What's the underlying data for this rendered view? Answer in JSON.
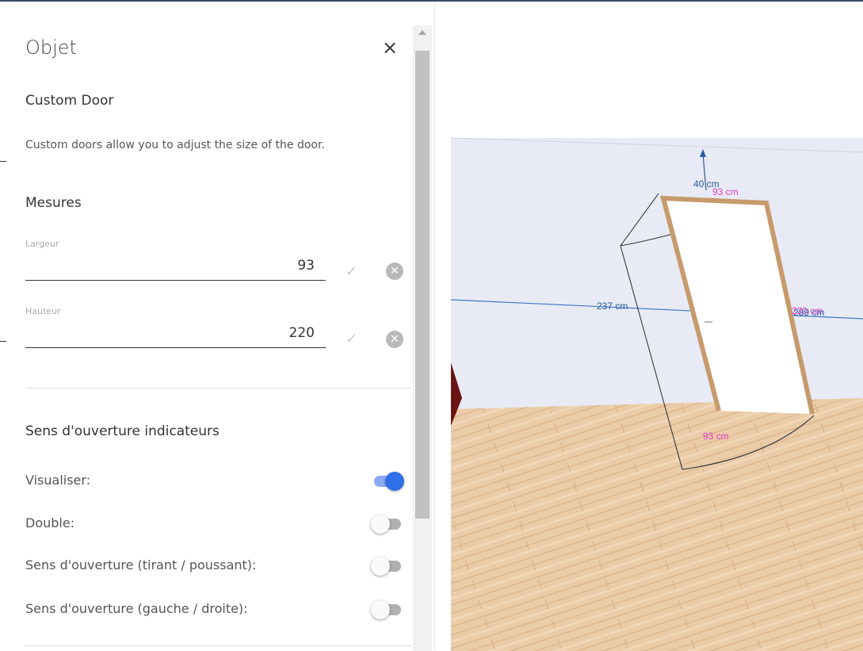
{
  "panel": {
    "title": "Objet",
    "close_glyph": "×",
    "object_name": "Custom Door",
    "description": "Custom doors allow you to adjust the size of the door.",
    "measures_title": "Mesures",
    "fields": [
      {
        "label": "Largeur",
        "value": "93"
      },
      {
        "label": "Hauteur",
        "value": "220"
      }
    ],
    "confirm_glyph": "✓",
    "clear_glyph": "✕",
    "options_title": "Sens d'ouverture indicateurs",
    "options": [
      {
        "label": "Visualiser:",
        "on": true
      },
      {
        "label": "Double:",
        "on": false
      },
      {
        "label": "Sens d'ouverture (tirant / poussant):",
        "on": false
      },
      {
        "label": "Sens d'ouverture (gauche / droite):",
        "on": false
      }
    ]
  },
  "viewport": {
    "labels": {
      "depth": "40 cm",
      "top_width": "93 cm",
      "left": "237 cm",
      "right": "220 cm",
      "right_overlap": "289 cm",
      "bottom_width": "93 cm"
    },
    "colors": {
      "wall": "#e8ebf5",
      "floor": "#e9c9a4",
      "door_frame": "#c79a6c",
      "measure_pink": "#e040c8",
      "measure_blue": "#2a5d9c",
      "baseline_blue": "#3e78c8"
    }
  }
}
